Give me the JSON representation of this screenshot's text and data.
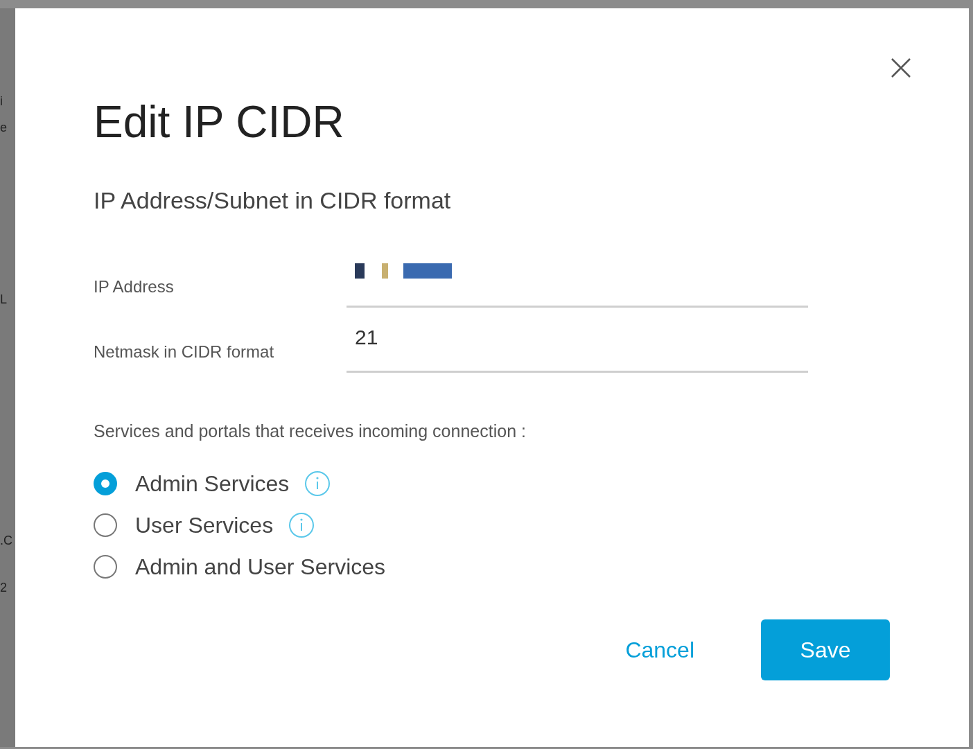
{
  "background_fragments": [
    "i",
    "e",
    "L",
    ".C",
    "2"
  ],
  "dialog": {
    "title": "Edit IP CIDR",
    "subtitle": "IP Address/Subnet in CIDR format",
    "fields": [
      {
        "label": "IP Address",
        "redacted": true
      },
      {
        "label": "Netmask in CIDR format",
        "value": "21",
        "redacted": false
      }
    ],
    "services_label": "Services and portals that receives incoming connection :",
    "options": [
      {
        "label": "Admin Services",
        "selected": true,
        "info": true
      },
      {
        "label": "User Services",
        "selected": false,
        "info": true
      },
      {
        "label": "Admin and User Services",
        "selected": false,
        "info": false
      }
    ],
    "buttons": [
      {
        "label": "Cancel",
        "kind": "link"
      },
      {
        "label": "Save",
        "kind": "primary"
      }
    ]
  }
}
